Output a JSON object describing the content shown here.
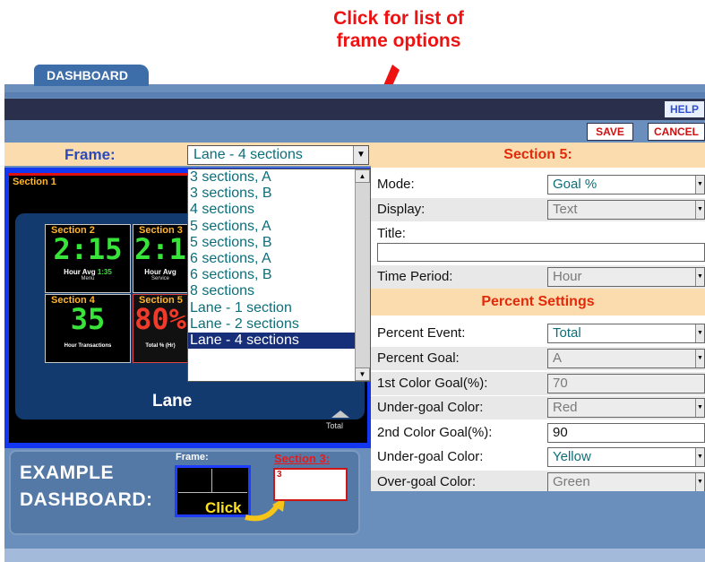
{
  "callout": {
    "line1": "Click for list of",
    "line2": "frame options"
  },
  "tab": {
    "label": "DASHBOARD"
  },
  "toolbar": {
    "help_label": "HELP",
    "save_label": "SAVE",
    "cancel_label": "CANCEL"
  },
  "frame": {
    "label": "Frame:",
    "selected": "Lane - 4 sections",
    "options": [
      "3 sections, A",
      "3 sections, B",
      "4 sections",
      "5 sections, A",
      "5 sections, B",
      "6 sections, A",
      "6 sections, B",
      "8 sections",
      "Lane - 1 section",
      "Lane - 2 sections",
      "Lane - 4 sections"
    ]
  },
  "preview": {
    "section1": "Section 1",
    "cells": {
      "c2": {
        "label": "Section 2",
        "value": "2:15",
        "sub_a": "Hour Avg",
        "sub_b": "1:35",
        "tiny": "Menu",
        "color": "#39e43a"
      },
      "c3": {
        "label": "Section 3",
        "value": "2:1",
        "sub_a": "Hour Avg",
        "tiny": "Service",
        "color": "#39e43a"
      },
      "c4": {
        "label": "Section 4",
        "value": "35",
        "sub_a": "Hour Transactions",
        "color": "#39e43a"
      },
      "c5": {
        "label": "Section 5",
        "value": "80%",
        "sub_a": "Total % (Hr)",
        "color": "#f23a2a"
      }
    },
    "lane_label": "Lane",
    "total_label": "Total"
  },
  "example": {
    "label_line1": "EXAMPLE",
    "label_line2": "DASHBOARD:",
    "frame_title": "Frame:",
    "click_label": "Click",
    "section3_title": "Section 3:",
    "section3_num": "3"
  },
  "settings": {
    "section_title": "Section 5:",
    "mode": {
      "label": "Mode:",
      "value": "Goal %"
    },
    "display": {
      "label": "Display:",
      "value": "Text"
    },
    "title": {
      "label": "Title:",
      "value": ""
    },
    "time_period": {
      "label": "Time Period:",
      "value": "Hour"
    },
    "percent_header": "Percent Settings",
    "percent_event": {
      "label": "Percent Event:",
      "value": "Total"
    },
    "percent_goal": {
      "label": "Percent Goal:",
      "value": "A"
    },
    "color_goal1": {
      "label": "1st Color Goal(%):",
      "value": "70"
    },
    "under_goal_color1": {
      "label": "Under-goal Color:",
      "value": "Red"
    },
    "color_goal2": {
      "label": "2nd Color Goal(%):",
      "value": "90"
    },
    "under_goal_color2": {
      "label": "Under-goal Color:",
      "value": "Yellow"
    },
    "over_goal_color": {
      "label": "Over-goal Color:",
      "value": "Green"
    }
  },
  "colors": {
    "accent_red": "#e12a0a",
    "shell_blue": "#6b8fbd",
    "peach": "#fbdcae",
    "list_text": "#0d6e7a",
    "selected_bg": "#172e79"
  }
}
